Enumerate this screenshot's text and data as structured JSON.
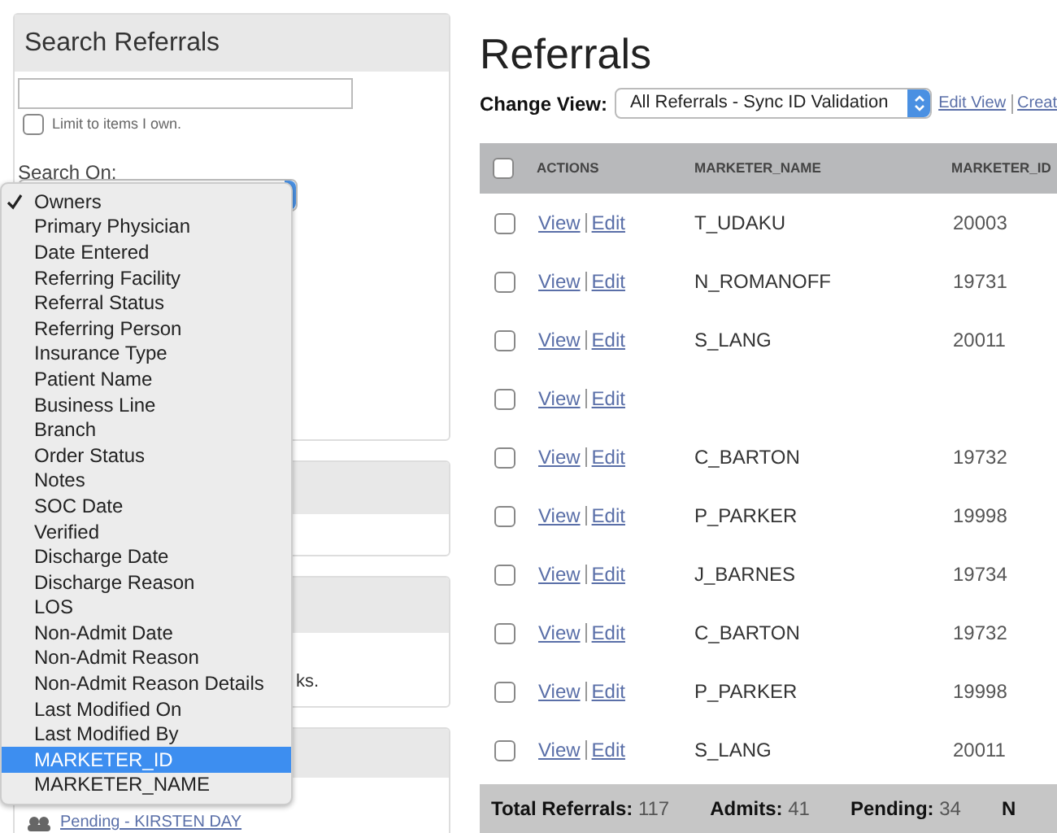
{
  "sidebar": {
    "search_panel": {
      "title": "Search Referrals",
      "limit_checkbox": {
        "label": "Limit to items I own.",
        "checked": false
      },
      "search_on_label": "Search On:",
      "menu": [
        {
          "label": "Owners",
          "selected": true,
          "highlighted": false
        },
        {
          "label": "Primary Physician",
          "selected": false,
          "highlighted": false
        },
        {
          "label": "Date Entered",
          "selected": false,
          "highlighted": false
        },
        {
          "label": "Referring Facility",
          "selected": false,
          "highlighted": false
        },
        {
          "label": "Referral Status",
          "selected": false,
          "highlighted": false
        },
        {
          "label": "Referring Person",
          "selected": false,
          "highlighted": false
        },
        {
          "label": "Insurance Type",
          "selected": false,
          "highlighted": false
        },
        {
          "label": "Patient Name",
          "selected": false,
          "highlighted": false
        },
        {
          "label": "Business Line",
          "selected": false,
          "highlighted": false
        },
        {
          "label": "Branch",
          "selected": false,
          "highlighted": false
        },
        {
          "label": "Order Status",
          "selected": false,
          "highlighted": false
        },
        {
          "label": "Notes",
          "selected": false,
          "highlighted": false
        },
        {
          "label": "SOC Date",
          "selected": false,
          "highlighted": false
        },
        {
          "label": "Verified",
          "selected": false,
          "highlighted": false
        },
        {
          "label": "Discharge Date",
          "selected": false,
          "highlighted": false
        },
        {
          "label": "Discharge Reason",
          "selected": false,
          "highlighted": false
        },
        {
          "label": "LOS",
          "selected": false,
          "highlighted": false
        },
        {
          "label": "Non-Admit Date",
          "selected": false,
          "highlighted": false
        },
        {
          "label": "Non-Admit Reason",
          "selected": false,
          "highlighted": false
        },
        {
          "label": "Non-Admit Reason Details",
          "selected": false,
          "highlighted": false
        },
        {
          "label": "Last Modified On",
          "selected": false,
          "highlighted": false
        },
        {
          "label": "Last Modified By",
          "selected": false,
          "highlighted": false
        },
        {
          "label": "MARKETER_ID",
          "selected": false,
          "highlighted": true
        },
        {
          "label": "MARKETER_NAME",
          "selected": false,
          "highlighted": false
        }
      ]
    },
    "panel_3_text": "ks.",
    "panel_4_item": "Pending - KIRSTEN DAY"
  },
  "main": {
    "title": "Referrals",
    "change_view": {
      "label": "Change View:",
      "value": "All Referrals - Sync ID Validation",
      "links": [
        "Edit View",
        "Creat"
      ]
    },
    "table": {
      "header_checked": false,
      "columns": [
        "ACTIONS",
        "MARKETER_NAME",
        "MARKETER_ID"
      ],
      "rows": [
        {
          "checked": false,
          "view": "View",
          "edit": "Edit",
          "name": "T_UDAKU",
          "id": "20003"
        },
        {
          "checked": false,
          "view": "View",
          "edit": "Edit",
          "name": "N_ROMANOFF",
          "id": "19731"
        },
        {
          "checked": false,
          "view": "View",
          "edit": "Edit",
          "name": "S_LANG",
          "id": "20011"
        },
        {
          "checked": false,
          "view": "View",
          "edit": "Edit"
        },
        {
          "checked": false,
          "view": "View",
          "edit": "Edit",
          "name": "C_BARTON",
          "id": "19732"
        },
        {
          "checked": false,
          "view": "View",
          "edit": "Edit",
          "name": "P_PARKER",
          "id": "19998"
        },
        {
          "checked": false,
          "view": "View",
          "edit": "Edit",
          "name": "J_BARNES",
          "id": "19734"
        },
        {
          "checked": false,
          "view": "View",
          "edit": "Edit",
          "name": "C_BARTON",
          "id": "19732"
        },
        {
          "checked": false,
          "view": "View",
          "edit": "Edit",
          "name": "P_PARKER",
          "id": "19998"
        },
        {
          "checked": false,
          "view": "View",
          "edit": "Edit",
          "name": "S_LANG",
          "id": "20011"
        }
      ]
    },
    "totals": [
      {
        "label": "Total Referrals:",
        "value": "117"
      },
      {
        "label": "Admits:",
        "value": "41"
      },
      {
        "label": "Pending:",
        "value": "34"
      },
      {
        "label": "N"
      }
    ]
  }
}
